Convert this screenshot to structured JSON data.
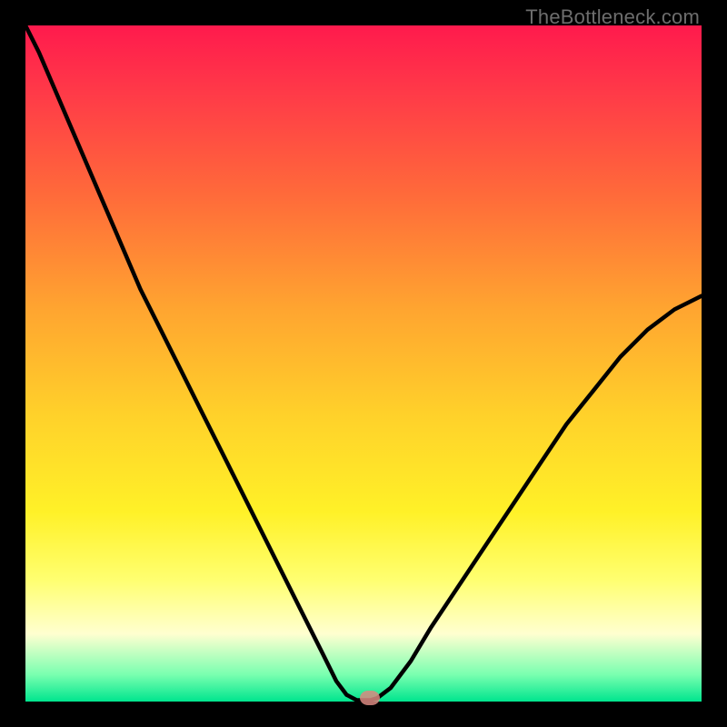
{
  "watermark": "TheBottleneck.com",
  "colors": {
    "background": "#000000",
    "gradient_top": "#ff1a4d",
    "gradient_bottom": "#00e58e",
    "curve": "#000000",
    "dot": "#d98880"
  },
  "chart_data": {
    "type": "line",
    "title": "",
    "xlabel": "",
    "ylabel": "",
    "xlim": [
      0,
      100
    ],
    "ylim": [
      0,
      100
    ],
    "x": [
      0,
      2,
      5,
      8,
      11,
      14,
      17,
      20,
      23,
      26,
      29,
      32,
      35,
      38,
      41,
      44,
      46,
      47.5,
      49,
      50,
      51,
      52,
      54,
      57,
      60,
      64,
      68,
      72,
      76,
      80,
      84,
      88,
      92,
      96,
      100
    ],
    "y": [
      100,
      96,
      89,
      82,
      75,
      68,
      61,
      55,
      49,
      43,
      37,
      31,
      25,
      19,
      13,
      7,
      3,
      1,
      0.2,
      0.2,
      0.2,
      0.5,
      2,
      6,
      11,
      17,
      23,
      29,
      35,
      41,
      46,
      51,
      55,
      58,
      60
    ],
    "dip_point": {
      "x": 50,
      "y": 0.5
    },
    "marker": {
      "x": 51,
      "y": 0.5
    }
  }
}
